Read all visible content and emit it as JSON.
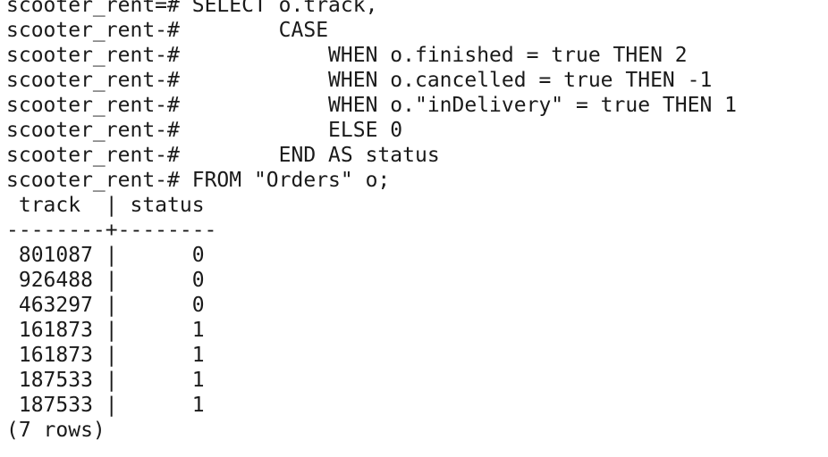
{
  "terminal": {
    "query_lines": [
      {
        "prompt": "scooter_rent=#",
        "text": " SELECT o.track,"
      },
      {
        "prompt": "scooter_rent-#",
        "text": "        CASE"
      },
      {
        "prompt": "scooter_rent-#",
        "text": "            WHEN o.finished = true THEN 2"
      },
      {
        "prompt": "scooter_rent-#",
        "text": "            WHEN o.cancelled = true THEN -1"
      },
      {
        "prompt": "scooter_rent-#",
        "text": "            WHEN o.\"inDelivery\" = true THEN 1"
      },
      {
        "prompt": "scooter_rent-#",
        "text": "            ELSE 0"
      },
      {
        "prompt": "scooter_rent-#",
        "text": "        END AS status"
      },
      {
        "prompt": "scooter_rent-#",
        "text": " FROM \"Orders\" o;"
      }
    ],
    "result": {
      "header": " track  | status",
      "separator": "--------+--------",
      "rows": [
        " 801087 |      0",
        " 926488 |      0",
        " 463297 |      0",
        " 161873 |      1",
        " 161873 |      1",
        " 187533 |      1",
        " 187533 |      1"
      ],
      "footer": "(7 rows)"
    }
  }
}
